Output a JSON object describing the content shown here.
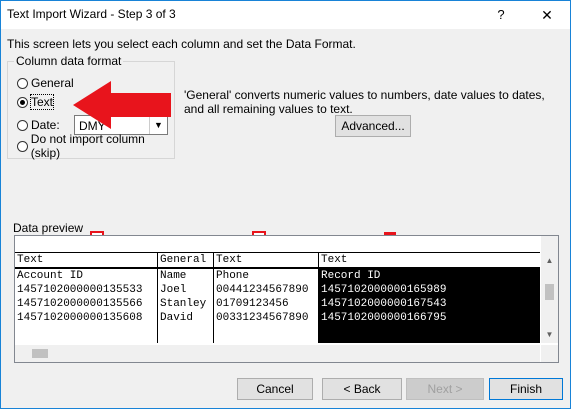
{
  "window": {
    "title": "Text Import Wizard - Step 3 of 3",
    "help_label": "?",
    "close_label": "✕"
  },
  "intro_text": "This screen lets you select each column and set the Data Format.",
  "column_format": {
    "group_title": "Column data format",
    "options": [
      {
        "label": "General",
        "checked": false
      },
      {
        "label": "Text",
        "checked": true
      },
      {
        "label": "Date:",
        "checked": false
      },
      {
        "label": "Do not import column (skip)",
        "checked": false
      }
    ],
    "date_value": "DMY"
  },
  "description": "'General' converts numeric values to numbers, date values to dates, and all remaining values to text.",
  "advanced_label": "Advanced...",
  "preview": {
    "title": "Data preview",
    "columns": [
      {
        "type": "Text",
        "cells": [
          "Account ID",
          "1457102000000135533",
          "1457102000000135566",
          "1457102000000135608"
        ],
        "selected": false
      },
      {
        "type": "General",
        "cells": [
          "Name",
          "Joel",
          "Stanley",
          "David"
        ],
        "selected": false
      },
      {
        "type": "Text",
        "cells": [
          "Phone",
          "00441234567890",
          "01709123456",
          "00331234567890"
        ],
        "selected": false
      },
      {
        "type": "Text",
        "cells": [
          "Record ID",
          "1457102000000165989",
          "1457102000000167543",
          "1457102000000166795"
        ],
        "selected": true
      }
    ]
  },
  "buttons": {
    "cancel": "Cancel",
    "back": "< Back",
    "next": "Next >",
    "finish": "Finish"
  },
  "colors": {
    "accent": "#0078d7",
    "annotation_red": "#e8141c"
  }
}
